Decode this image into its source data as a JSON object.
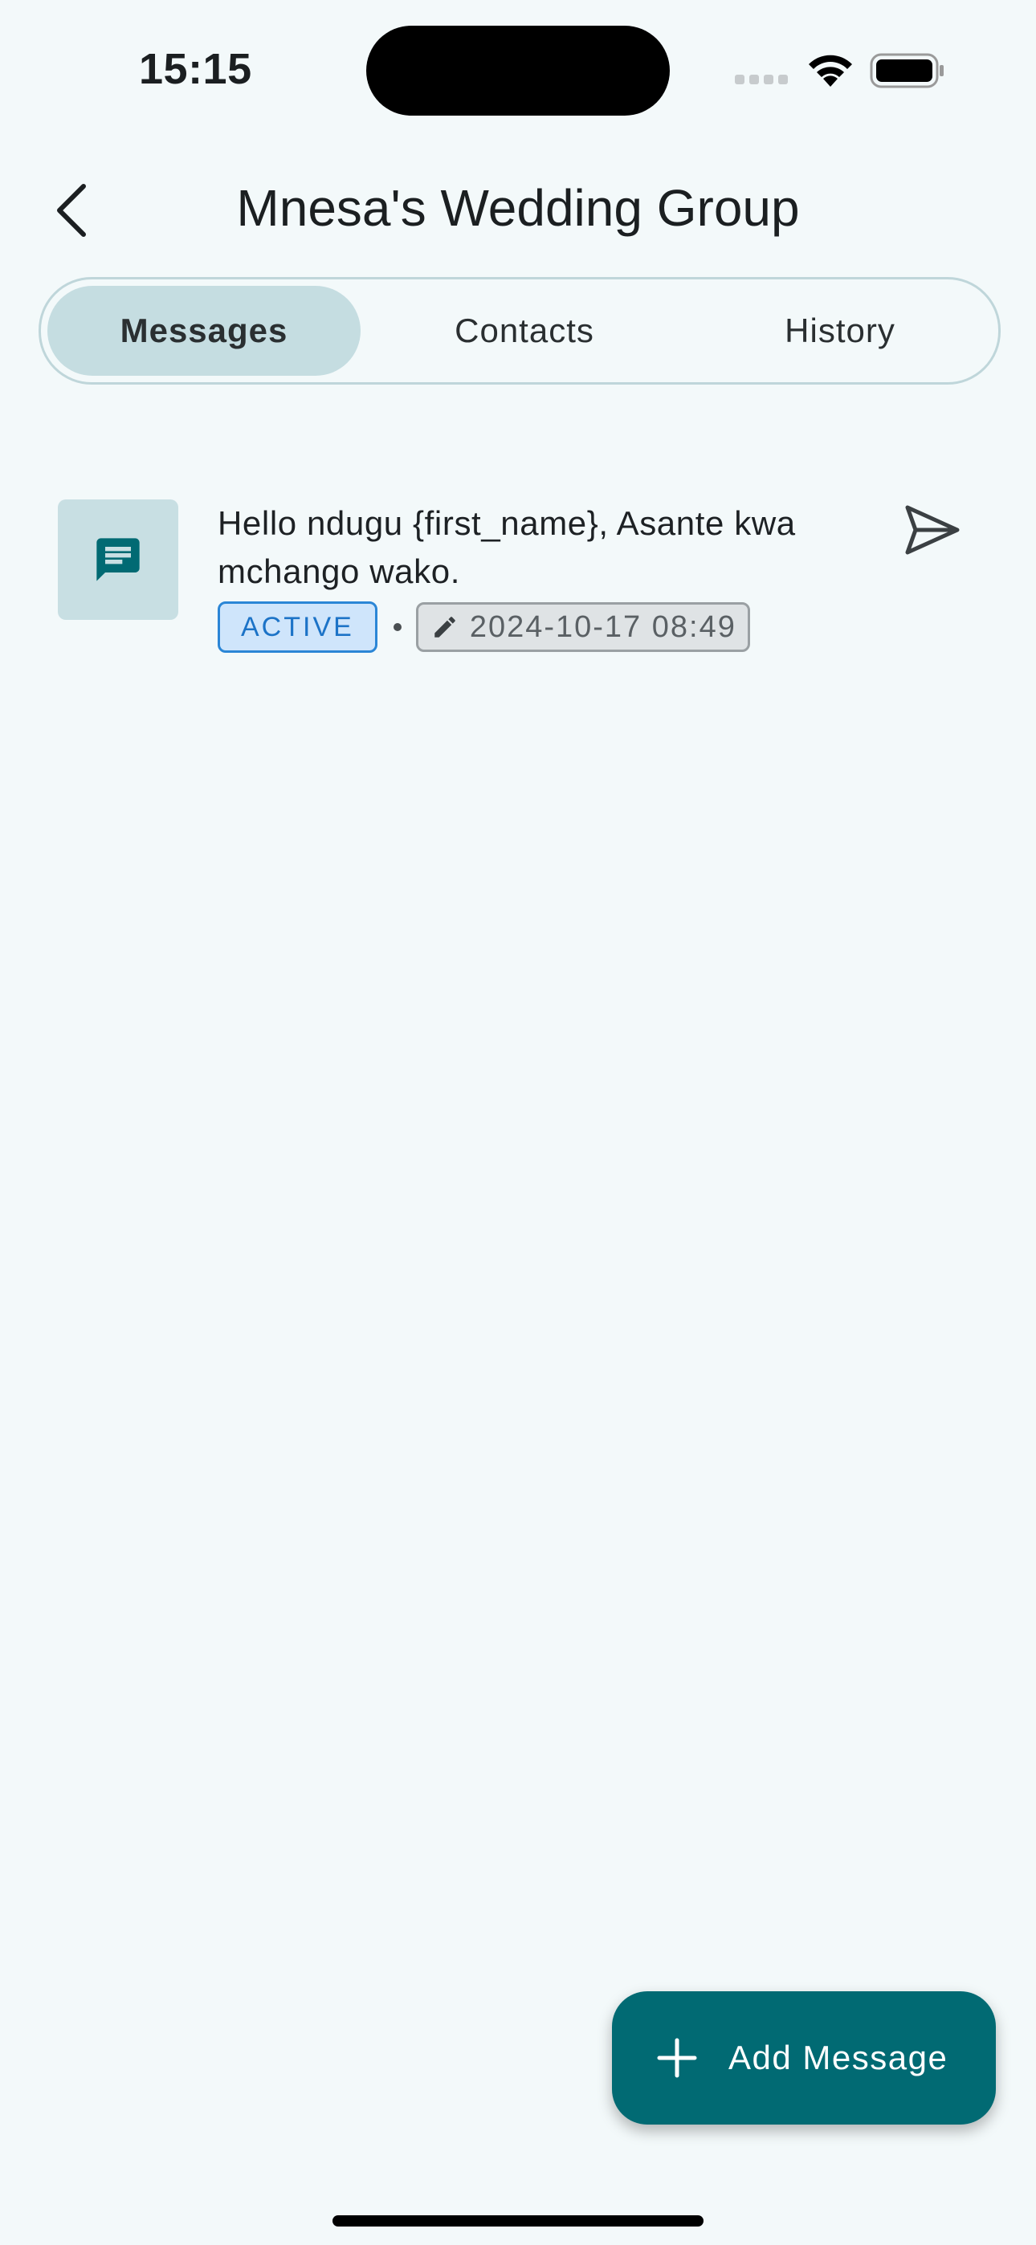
{
  "status_bar": {
    "time": "15:15"
  },
  "header": {
    "title": "Mnesa's Wedding Group",
    "back_icon": "chevron-left-icon"
  },
  "tabs": [
    {
      "label": "Messages",
      "selected": true
    },
    {
      "label": "Contacts",
      "selected": false
    },
    {
      "label": "History",
      "selected": false
    }
  ],
  "messages": [
    {
      "icon": "message-icon",
      "text": "Hello ndugu {first_name}, Asante kwa mchango wako.",
      "status": "ACTIVE",
      "separator": "•",
      "edited_at": "2024-10-17 08:49",
      "edited_icon": "pencil-icon",
      "action_icon": "send-icon"
    }
  ],
  "fab": {
    "label": "Add Message",
    "icon": "plus-icon"
  },
  "colors": {
    "accent": "#016a73",
    "background": "#f3f9fa",
    "tab_selected": "#c5dde1",
    "status_active": "#1c73c7"
  }
}
